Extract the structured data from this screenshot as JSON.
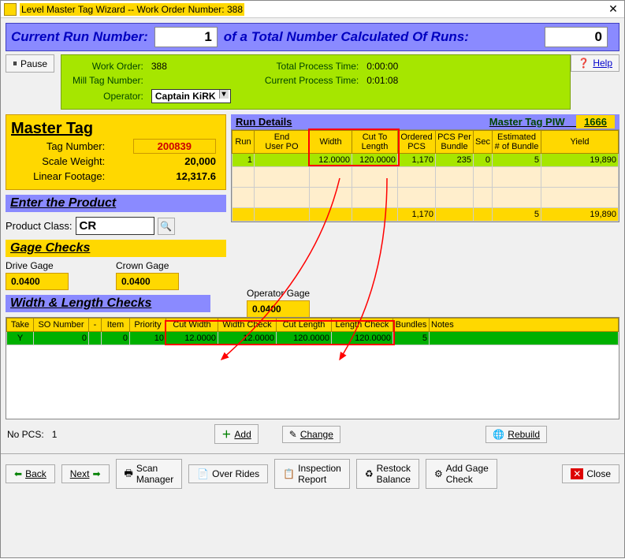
{
  "window": {
    "title_prefix": "Level Master Tag Wizard -- Work Order Number: ",
    "title_value": "388"
  },
  "runbar": {
    "label_current": "Current Run Number:",
    "current": "1",
    "label_total": "of a Total Number Calculated Of Runs:",
    "total": "0"
  },
  "top": {
    "pause": "Pause",
    "help": "Help",
    "work_order_lbl": "Work Order:",
    "work_order": "388",
    "mill_tag_lbl": "Mill Tag Number:",
    "mill_tag": "",
    "operator_lbl": "Operator:",
    "operator": "Captain KiRK",
    "total_time_lbl": "Total Process Time:",
    "total_time": "0:00:00",
    "current_time_lbl": "Current Process Time:",
    "current_time": "0:01:08"
  },
  "master_tag": {
    "header": "Master Tag",
    "tag_lbl": "Tag Number:",
    "tag": "200839",
    "scale_lbl": "Scale Weight:",
    "scale": "20,000",
    "linear_lbl": "Linear Footage:",
    "linear": "12,317.6"
  },
  "product": {
    "header": "Enter the Product",
    "class_lbl": "Product Class:",
    "class": "CR"
  },
  "gage": {
    "header": "Gage Checks",
    "drive_lbl": "Drive Gage",
    "drive": "0.0400",
    "crown_lbl": "Crown Gage",
    "crown": "0.0400",
    "op_lbl": "Operator Gage",
    "op": "0.0400"
  },
  "run_details": {
    "header": "Run Details",
    "piw_lbl": "Master Tag PIW",
    "piw": "1666",
    "cols": [
      "Run",
      "End\nUser PO",
      "Width",
      "Cut To\nLength",
      "Ordered\nPCS",
      "PCS Per\nBundle",
      "Sec",
      "Estimated\n# of Bundle",
      "Yield"
    ],
    "row": {
      "run": "1",
      "po": "",
      "width": "12.0000",
      "cutlen": "120.0000",
      "ordered": "1,170",
      "perbundle": "235",
      "sec": "0",
      "estbundle": "5",
      "yield": "19,890"
    },
    "totals": {
      "ordered": "1,170",
      "estbundle": "5",
      "yield": "19,890"
    }
  },
  "wl": {
    "header": "Width & Length Checks",
    "cols": [
      "Take",
      "SO Number",
      "-",
      "Item",
      "Priority",
      "Cut Width",
      "Width Check",
      "Cut Length",
      "Length Check",
      "Bundles",
      "Notes"
    ],
    "row": {
      "take": "Y",
      "so": "0",
      "dash": "",
      "item": "0",
      "pri": "10",
      "cw": "12.0000",
      "wc": "12.0000",
      "cl": "120.0000",
      "lc": "120.0000",
      "bundles": "5",
      "notes": ""
    },
    "nopcs_lbl": "No PCS:",
    "nopcs": "1",
    "add": "Add",
    "change": "Change",
    "rebuild": "Rebuild"
  },
  "footer": {
    "back": "Back",
    "next": "Next",
    "scan": "Scan Manager",
    "over": "Over Rides",
    "insp": "Inspection Report",
    "restock": "Restock Balance",
    "gage": "Add Gage Check",
    "close": "Close"
  }
}
